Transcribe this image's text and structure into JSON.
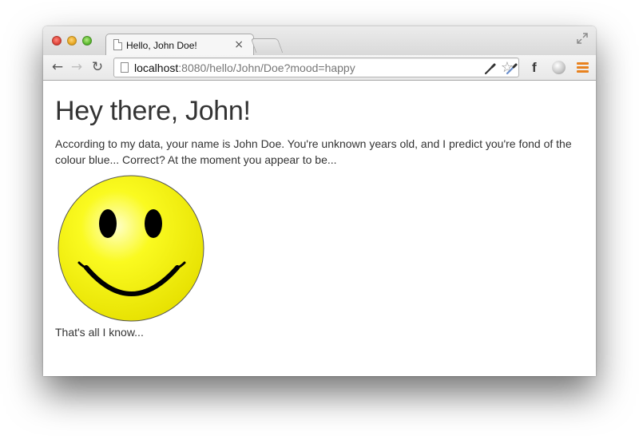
{
  "window": {
    "tab_title": "Hello, John Doe!",
    "tab_close_glyph": "×"
  },
  "toolbar": {
    "url_host": "localhost",
    "url_rest": ":8080/hello/John/Doe?mood=happy",
    "extensions": [
      "eyedropper-icon",
      "eyedropper-icon",
      "facebook-icon",
      "globe-icon",
      "menu-icon"
    ]
  },
  "page": {
    "heading": "Hey there, John!",
    "paragraph": "According to my data, your name is John Doe. You're unknown years old, and I predict you're fond of the colour blue... Correct? At the moment you appear to be...",
    "footer": "That's all I know..."
  },
  "colors": {
    "smiley_fill": "#f7f400",
    "menu_accent": "#e8821f",
    "text": "#333333"
  }
}
